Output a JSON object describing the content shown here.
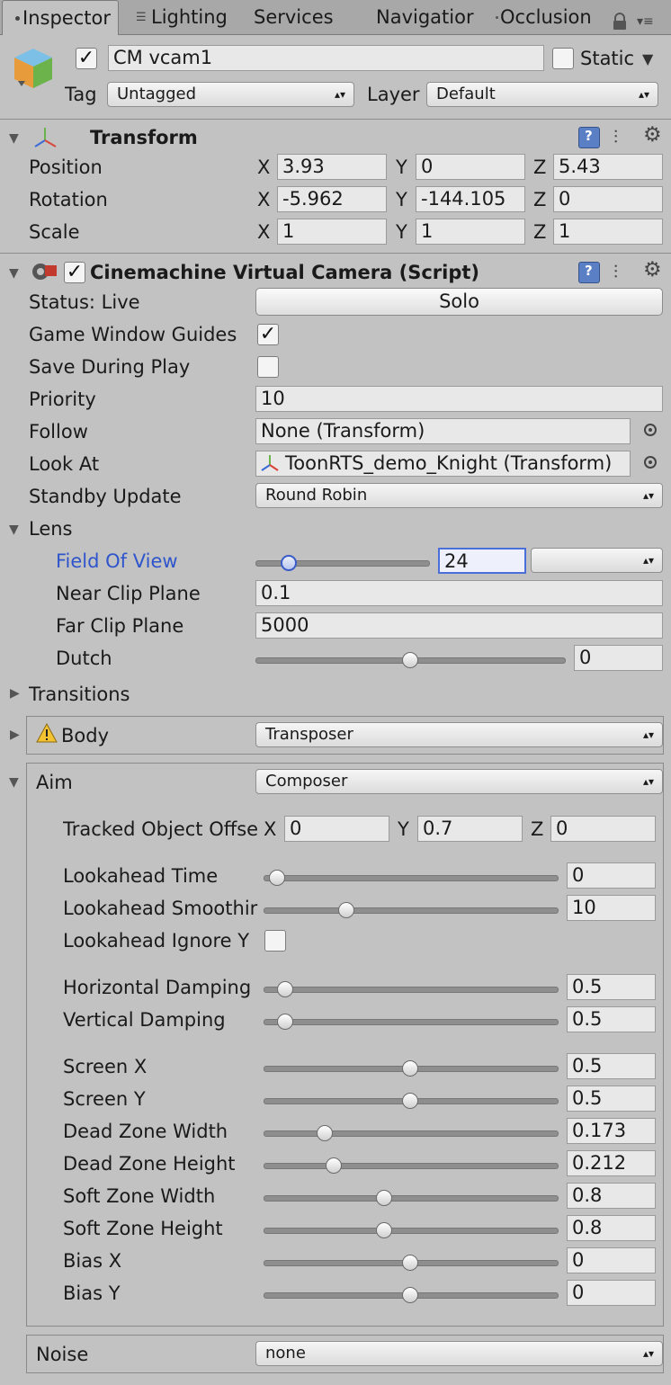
{
  "tabs": [
    {
      "label": "Inspector",
      "active": true
    },
    {
      "label": "Lighting"
    },
    {
      "label": "Services"
    },
    {
      "label": "Navigatior"
    },
    {
      "label": "Occlusion"
    }
  ],
  "object": {
    "name": "CM vcam1",
    "enabled": true,
    "static_label": "Static",
    "static": false,
    "tag_label": "Tag",
    "tag_value": "Untagged",
    "layer_label": "Layer",
    "layer_value": "Default"
  },
  "transform": {
    "title": "Transform",
    "rows": [
      {
        "label": "Position",
        "x": "3.93",
        "y": "0",
        "z": "5.43"
      },
      {
        "label": "Rotation",
        "x": "-5.962",
        "y": "-144.105",
        "z": "0"
      },
      {
        "label": "Scale",
        "x": "1",
        "y": "1",
        "z": "1"
      }
    ]
  },
  "vcam": {
    "title": "Cinemachine Virtual Camera (Script)",
    "status_label": "Status: Live",
    "solo_label": "Solo",
    "game_window_guides_label": "Game Window Guides",
    "game_window_guides": true,
    "save_during_play_label": "Save During Play",
    "save_during_play": false,
    "priority_label": "Priority",
    "priority": "10",
    "follow_label": "Follow",
    "follow": "None (Transform)",
    "lookat_label": "Look At",
    "lookat": "ToonRTS_demo_Knight (Transform)",
    "standby_label": "Standby Update",
    "standby": "Round Robin"
  },
  "lens": {
    "label": "Lens",
    "fov_label": "Field Of View",
    "fov": "24",
    "fov_fraction": 0.16,
    "near_label": "Near Clip Plane",
    "near": "0.1",
    "far_label": "Far Clip Plane",
    "far": "5000",
    "dutch_label": "Dutch",
    "dutch": "0",
    "dutch_fraction": 0.5
  },
  "transitions_label": "Transitions",
  "body": {
    "label": "Body",
    "value": "Transposer"
  },
  "aim": {
    "label": "Aim",
    "value": "Composer",
    "tracked_label": "Tracked Object Offse",
    "tracked": {
      "x": "0",
      "y": "0.7",
      "z": "0"
    },
    "sliders": [
      {
        "label": "Lookahead Time",
        "value": "0",
        "fraction": 0.02
      },
      {
        "label": "Lookahead Smoothir",
        "value": "10",
        "fraction": 0.27
      },
      {
        "label": "Horizontal Damping",
        "value": "0.5",
        "fraction": 0.05
      },
      {
        "label": "Vertical Damping",
        "value": "0.5",
        "fraction": 0.05
      },
      {
        "label": "Screen X",
        "value": "0.5",
        "fraction": 0.5
      },
      {
        "label": "Screen Y",
        "value": "0.5",
        "fraction": 0.5
      },
      {
        "label": "Dead Zone Width",
        "value": "0.173",
        "fraction": 0.19
      },
      {
        "label": "Dead Zone Height",
        "value": "0.212",
        "fraction": 0.225
      },
      {
        "label": "Soft Zone Width",
        "value": "0.8",
        "fraction": 0.405
      },
      {
        "label": "Soft Zone Height",
        "value": "0.8",
        "fraction": 0.405
      },
      {
        "label": "Bias X",
        "value": "0",
        "fraction": 0.5
      },
      {
        "label": "Bias Y",
        "value": "0",
        "fraction": 0.5
      }
    ],
    "lookahead_ignore_label": "Lookahead Ignore Y",
    "lookahead_ignore": false
  },
  "noise": {
    "label": "Noise",
    "value": "none"
  },
  "axes": {
    "x": "X",
    "y": "Y",
    "z": "Z"
  }
}
